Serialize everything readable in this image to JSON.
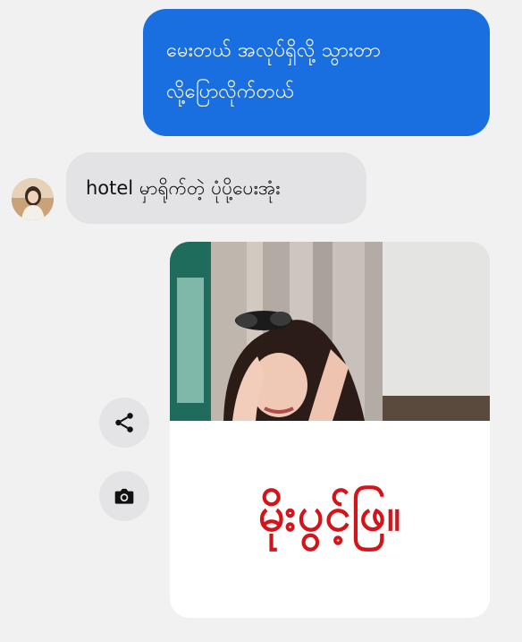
{
  "messages": {
    "outgoing_line1": "မေးတယ် အလုပ်ရှိလို့ သွားတာ",
    "outgoing_line2": "လို့ပြောလိုက်တယ်",
    "incoming_text": "hotel မှာရိုက်တဲ့ ပုံပို့ပေးအုံး",
    "media_caption": "မိုးပွင့်ဖြ။"
  },
  "actions": {
    "share_icon": "share-icon",
    "camera_icon": "camera-icon"
  },
  "colors": {
    "outgoing_bubble": "#1a6fe0",
    "incoming_bubble": "#e3e3e5",
    "caption_red": "#d2151b",
    "background": "#f1f1f2"
  }
}
